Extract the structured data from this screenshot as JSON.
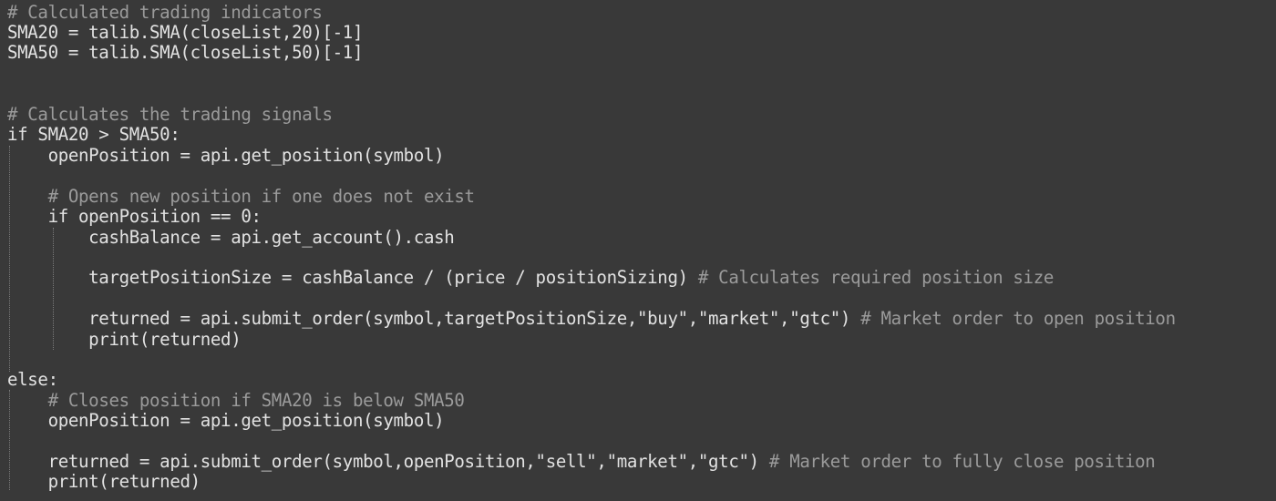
{
  "editor": {
    "theme_colors": {
      "background": "#393939",
      "code_text": "#e2e2e2",
      "comment_text": "#9b9b9b",
      "indent_guide": "#7a7a7a"
    },
    "lines": [
      {
        "code": "",
        "comment": "# Calculated trading indicators"
      },
      {
        "code": "SMA20 = talib.SMA(closeList,20)[-1]",
        "comment": ""
      },
      {
        "code": "SMA50 = talib.SMA(closeList,50)[-1]",
        "comment": ""
      },
      {
        "code": "",
        "comment": ""
      },
      {
        "code": "",
        "comment": ""
      },
      {
        "code": "",
        "comment": "# Calculates the trading signals"
      },
      {
        "code": "if SMA20 > SMA50:",
        "comment": ""
      },
      {
        "code": "    openPosition = api.get_position(symbol)",
        "comment": ""
      },
      {
        "code": "",
        "comment": ""
      },
      {
        "code": "    ",
        "comment": "# Opens new position if one does not exist"
      },
      {
        "code": "    if openPosition == 0:",
        "comment": ""
      },
      {
        "code": "        cashBalance = api.get_account().cash",
        "comment": ""
      },
      {
        "code": "",
        "comment": ""
      },
      {
        "code": "        targetPositionSize = cashBalance / (price / positionSizing) ",
        "comment": "# Calculates required position size"
      },
      {
        "code": "",
        "comment": ""
      },
      {
        "code": "        returned = api.submit_order(symbol,targetPositionSize,\"buy\",\"market\",\"gtc\") ",
        "comment": "# Market order to open position"
      },
      {
        "code": "        print(returned)",
        "comment": ""
      },
      {
        "code": "",
        "comment": ""
      },
      {
        "code": "else:",
        "comment": ""
      },
      {
        "code": "    ",
        "comment": "# Closes position if SMA20 is below SMA50"
      },
      {
        "code": "    openPosition = api.get_position(symbol)",
        "comment": ""
      },
      {
        "code": "",
        "comment": ""
      },
      {
        "code": "    returned = api.submit_order(symbol,openPosition,\"sell\",\"market\",\"gtc\") ",
        "comment": "# Market order to fully close position"
      },
      {
        "code": "    print(returned)",
        "comment": ""
      }
    ]
  }
}
